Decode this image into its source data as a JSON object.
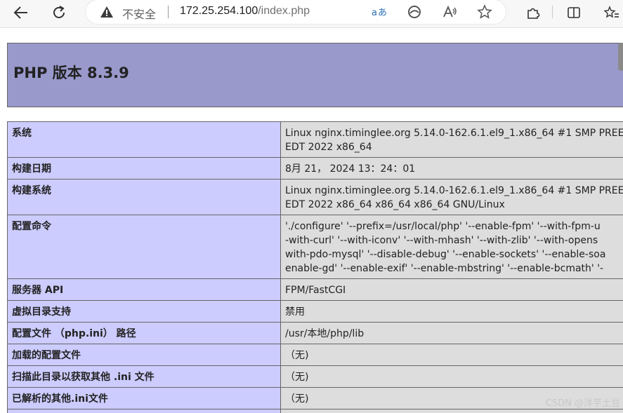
{
  "browser": {
    "security_label": "不安全",
    "url_host": "172.25.254.100",
    "url_path": "/index.php"
  },
  "page": {
    "title": "PHP 版本 8.3.9"
  },
  "rows": [
    {
      "key": "系统",
      "value": [
        "Linux nginx.timinglee.org 5.14.0-162.6.1.el9_1.x86_64 #1 SMP PREE",
        "EDT 2022 x86_64"
      ]
    },
    {
      "key": "构建日期",
      "value": [
        "8月 21， 2024 13：24：01"
      ]
    },
    {
      "key": "构建系统",
      "value": [
        "Linux nginx.timinglee.org 5.14.0-162.6.1.el9_1.x86_64 #1 SMP PREE",
        "EDT 2022 x86_64 x86_64 x86_64 GNU/Linux"
      ]
    },
    {
      "key": "配置命令",
      "value": [
        "'./configure' '--prefix=/usr/local/php' '--enable-fpm' '--with-fpm-u",
        "-with-curl' '--with-iconv' '--with-mhash' '--with-zlib' '--with-opens",
        "with-pdo-mysql' '--disable-debug' '--enable-sockets' '--enable-soa",
        "enable-gd' '--enable-exif' '--enable-mbstring' '--enable-bcmath' '-"
      ]
    },
    {
      "key": "服务器 API",
      "value": [
        "FPM/FastCGI"
      ]
    },
    {
      "key": "虚拟目录支持",
      "value": [
        "禁用"
      ]
    },
    {
      "key": "配置文件 （php.ini） 路径",
      "value": [
        "/usr/本地/php/lib"
      ]
    },
    {
      "key": "加载的配置文件",
      "value": [
        "（无)"
      ]
    },
    {
      "key": "扫描此目录以获取其他 .ini 文件",
      "value": [
        "（无)"
      ]
    },
    {
      "key": "已解析的其他.ini文件",
      "value": [
        "（无)"
      ]
    },
    {
      "key": "",
      "value": [
        ""
      ]
    }
  ],
  "watermark": "CSDN @洋芋土豆"
}
